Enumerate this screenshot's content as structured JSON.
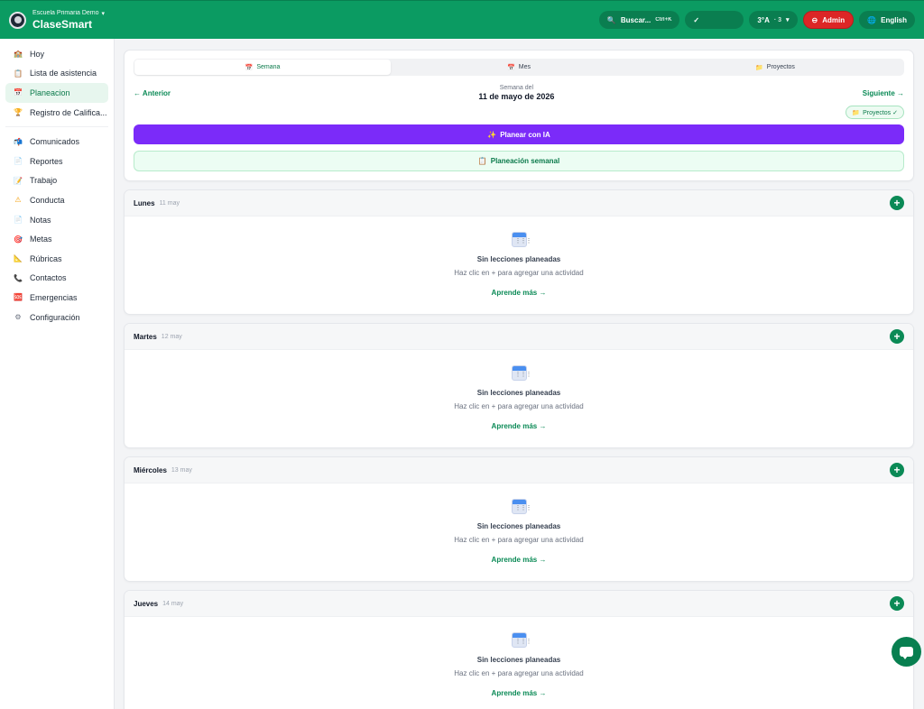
{
  "header": {
    "school": "Escuela Primaria Demo",
    "school_chevron": "▾",
    "app_name": "ClaseSmart",
    "search_label": "Buscar...",
    "search_shortcut": "Ctrl+K",
    "check_label": "✓",
    "grade_label": "3°A",
    "grade_count": "· 3",
    "grade_chevron": "▾",
    "admin_label": "Admin",
    "admin_icon": "⊖",
    "language_label": "English",
    "globe_icon": "🌐",
    "search_icon": "🔍",
    "accent_color": "#0b9b62"
  },
  "sidebar": {
    "items": [
      {
        "label": "Hoy",
        "icon": "🏫"
      },
      {
        "label": "Lista de asistencia",
        "icon": "📋"
      },
      {
        "label": "Planeacion",
        "icon": "📅",
        "active": true
      },
      {
        "label": "Registro de Califica...",
        "icon": "🏆"
      },
      {
        "label": "Comunicados",
        "icon": "📬"
      },
      {
        "label": "Reportes",
        "icon": "📄"
      },
      {
        "label": "Trabajo",
        "icon": "📝"
      },
      {
        "label": "Conducta",
        "icon": "⚠"
      },
      {
        "label": "Notas",
        "icon": "📄"
      },
      {
        "label": "Metas",
        "icon": "🎯"
      },
      {
        "label": "Rúbricas",
        "icon": "📐"
      },
      {
        "label": "Contactos",
        "icon": "📞"
      },
      {
        "label": "Emergencias",
        "icon": "🆘"
      },
      {
        "label": "Configuración",
        "icon": "⚙"
      }
    ]
  },
  "planner": {
    "tabs": [
      {
        "label": "Semana",
        "icon": "📅"
      },
      {
        "label": "Mes",
        "icon": "📅"
      },
      {
        "label": "Proyectos",
        "icon": "📁"
      }
    ],
    "prev_label": "← Anterior",
    "next_label": "Siguiente →",
    "week_caption": "Semana del",
    "week_date": "11 de mayo de 2026",
    "projects_badge": "Proyectos ✓",
    "projects_badge_icon": "📁",
    "ai_button": "Planear con IA",
    "ai_icon": "✨",
    "weekly_button": "Planeación semanal",
    "weekly_icon": "📋"
  },
  "days": [
    {
      "name": "Lunes",
      "date": "11 may"
    },
    {
      "name": "Martes",
      "date": "12 may"
    },
    {
      "name": "Miércoles",
      "date": "13 may"
    },
    {
      "name": "Jueves",
      "date": "14 may"
    }
  ],
  "empty_state": {
    "title": "Sin lecciones planeadas",
    "subtitle": "Haz clic en + para agregar una actividad",
    "learn_more": "Aprende más →",
    "add_symbol": "+"
  }
}
